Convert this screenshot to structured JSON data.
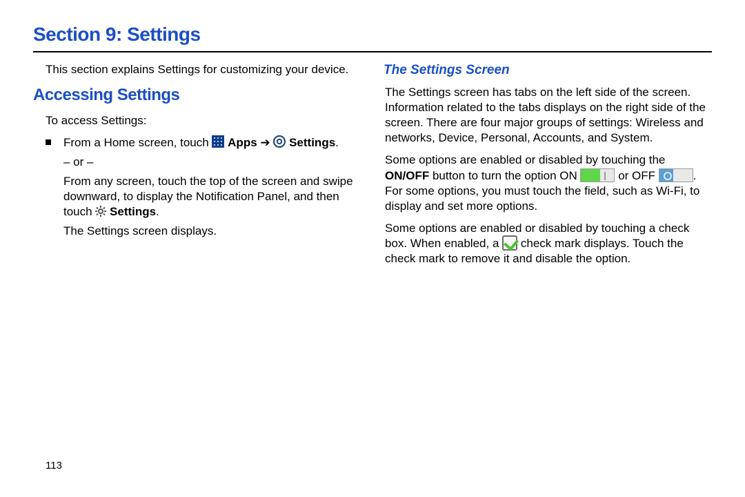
{
  "title": "Section 9: Settings",
  "intro": "This section explains Settings for customizing your device.",
  "left": {
    "heading": "Accessing Settings",
    "lead": "To access Settings:",
    "fromHomePrefix": "From a Home screen, touch ",
    "appsLabel": " Apps",
    "arrow": " ➔ ",
    "settingsLabel": " Settings",
    "period": ".",
    "or": "– or –",
    "anyScreen1": "From any screen, touch the top of the screen and swipe downward, to display the Notification Panel, and then touch ",
    "settingsLabel2": " Settings",
    "period2": ".",
    "displays": "The Settings screen displays."
  },
  "right": {
    "heading": "The Settings Screen",
    "para1": "The Settings screen has tabs on the left side of the screen. Information related to the tabs displays on the right side of the screen. There are four major groups of settings: Wireless and networks, Device, Personal, Accounts, and System.",
    "para2a": "Some options are enabled or disabled by touching the ",
    "onoff": "ON/OFF",
    "para2b": " button to turn the option ON ",
    "para2c": " or OFF ",
    "para2d": ". For some options, you must touch the field, such as Wi-Fi, to display and set more options.",
    "para3a": "Some options are enabled or disabled by touching a check box. When enabled, a ",
    "para3b": " check mark displays. Touch the check mark to remove it and disable the option."
  },
  "pageNumber": "113"
}
